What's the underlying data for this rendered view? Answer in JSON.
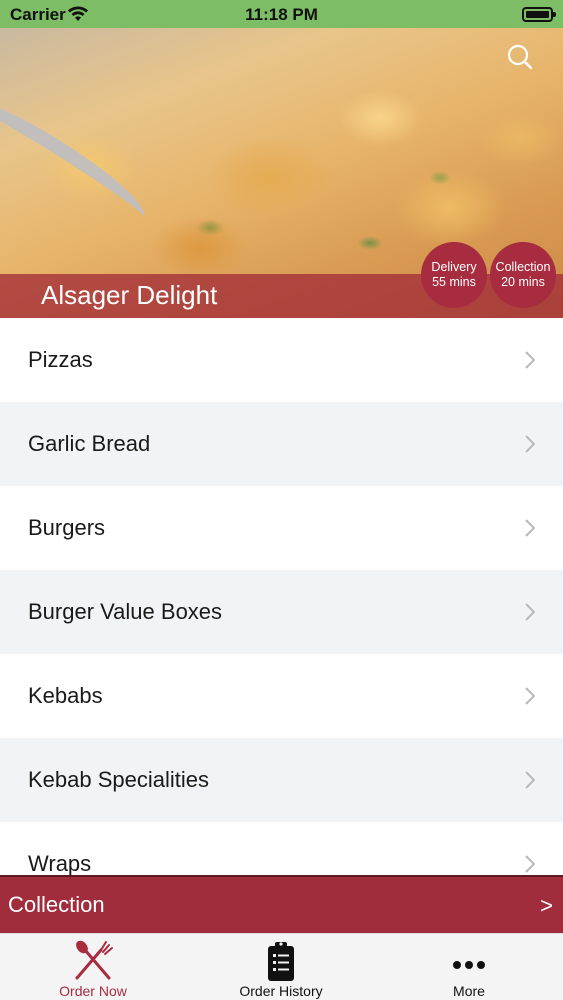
{
  "status_bar": {
    "carrier": "Carrier",
    "time": "11:18 PM",
    "bg_color": "#7cbd66"
  },
  "header": {
    "restaurant_name": "Alsager Delight",
    "delivery": {
      "label": "Delivery",
      "time": "55 mins"
    },
    "collection": {
      "label": "Collection",
      "time": "20 mins"
    },
    "search_icon": "search-icon",
    "accent_color": "#a82c3f"
  },
  "menu": {
    "items": [
      {
        "label": "Pizzas"
      },
      {
        "label": "Garlic Bread"
      },
      {
        "label": "Burgers"
      },
      {
        "label": "Burger Value Boxes"
      },
      {
        "label": "Kebabs"
      },
      {
        "label": "Kebab Specialities"
      },
      {
        "label": "Wraps"
      }
    ]
  },
  "order_mode": {
    "label": "Collection",
    "arrow": ">"
  },
  "tab_bar": {
    "tabs": [
      {
        "label": "Order Now",
        "icon": "fork-knife-icon",
        "active": true
      },
      {
        "label": "Order History",
        "icon": "clipboard-list-icon",
        "active": false
      },
      {
        "label": "More",
        "icon": "more-dots-icon",
        "active": false
      }
    ]
  }
}
